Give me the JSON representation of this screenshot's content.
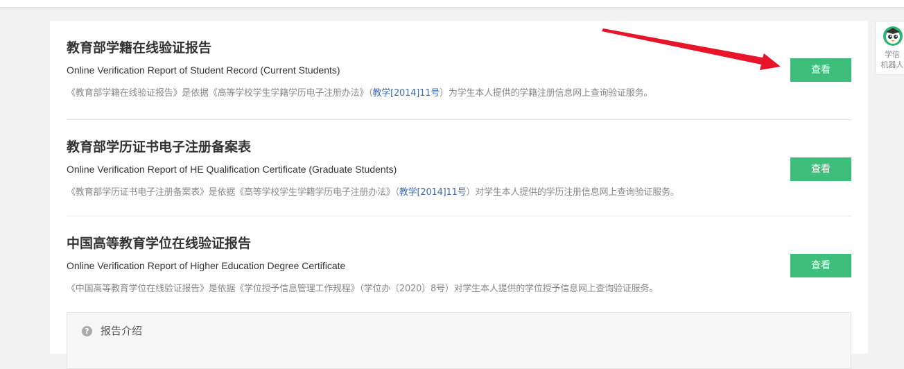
{
  "reports": [
    {
      "title_cn": "教育部学籍在线验证报告",
      "title_en": "Online Verification Report of Student Record (Current Students)",
      "desc_before": "《教育部学籍在线验证报告》是依据《高等学校学生学籍学历电子注册办法》（",
      "desc_link": "教学[2014]11号",
      "desc_after": "）为学生本人提供的学籍注册信息网上查询验证服务。",
      "button_label": "查看"
    },
    {
      "title_cn": "教育部学历证书电子注册备案表",
      "title_en": "Online Verification Report of HE Qualification Certificate (Graduate Students)",
      "desc_before": "《教育部学历证书电子注册备案表》是依据《高等学校学生学籍学历电子注册办法》（",
      "desc_link": "教学[2014]11号",
      "desc_after": "）对学生本人提供的学历注册信息网上查询验证服务。",
      "button_label": "查看"
    },
    {
      "title_cn": "中国高等教育学位在线验证报告",
      "title_en": "Online Verification Report of Higher Education Degree Certificate",
      "desc_before": "《中国高等教育学位在线验证报告》是依据《学位授予信息管理工作规程》（学位办〔2020〕8号）对学生本人提供的学位授予信息网上查询验证服务。",
      "desc_link": "",
      "desc_after": "",
      "button_label": "查看"
    }
  ],
  "intro": {
    "icon": "question-circle-icon",
    "icon_glyph": "?",
    "label": "报告介绍"
  },
  "robot": {
    "icon": "robot-avatar-icon",
    "label_line1": "学信",
    "label_line2": "机器人"
  },
  "colors": {
    "button_bg": "#3dbf7b",
    "link": "#3d6bb3",
    "annotation_arrow": "#e8152a"
  }
}
